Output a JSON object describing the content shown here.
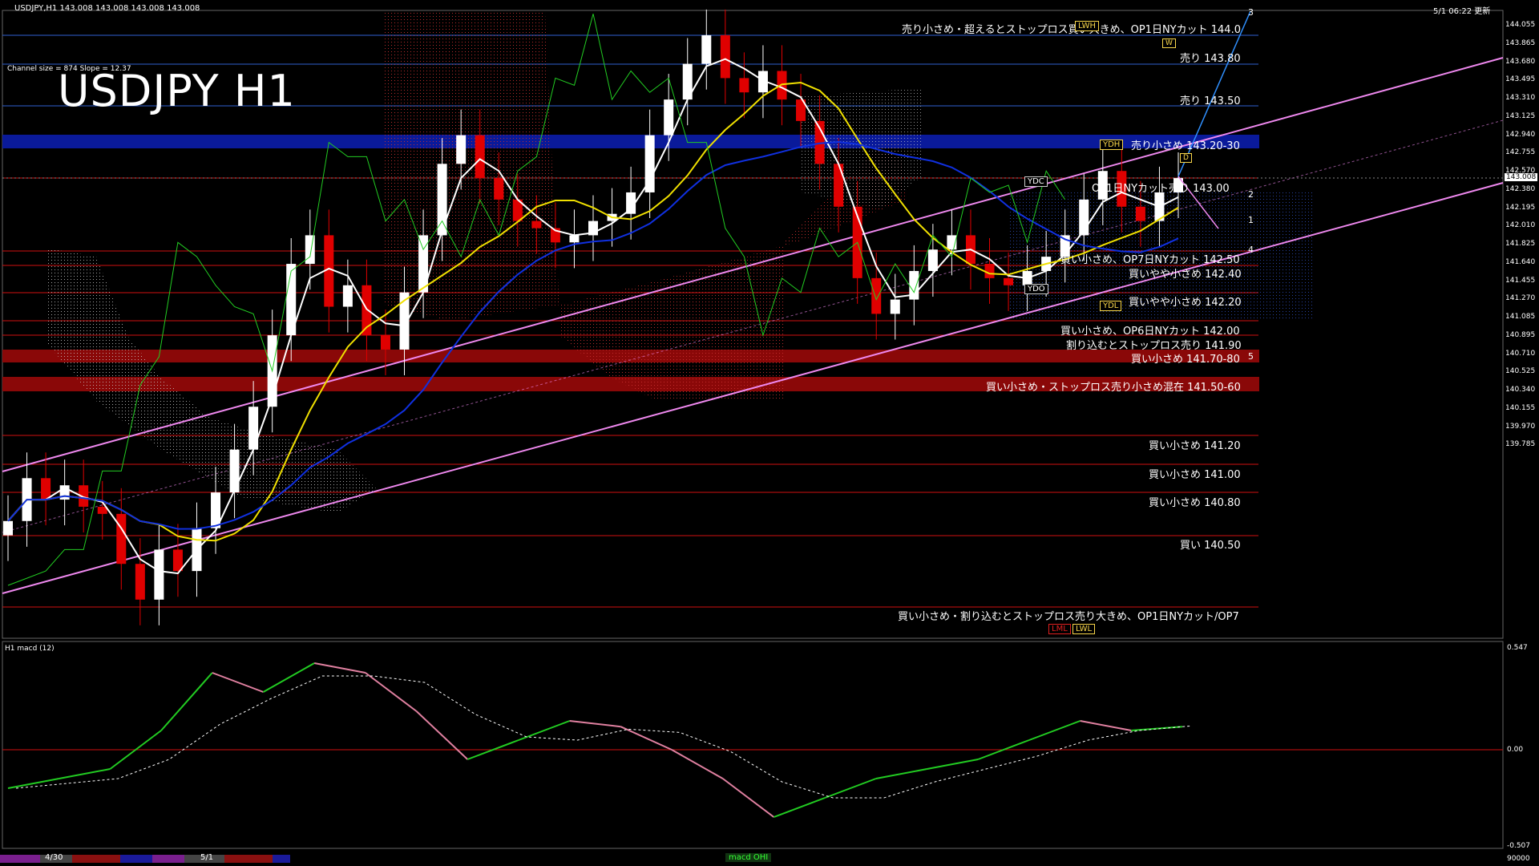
{
  "header": {
    "symbol_info": "USDJPY,H1  143.008 143.008 143.008 143.008",
    "datetime": "5/1 06:22 更新",
    "channel_info": "Channel size = 874 Slope = 12.37",
    "big_title": "USDJPY H1",
    "macd_label": "H1  macd (12)"
  },
  "price_axis": [
    "144.055",
    "143.865",
    "143.680",
    "143.495",
    "143.310",
    "143.125",
    "142.940",
    "142.755",
    "142.570",
    "142.380",
    "142.195",
    "142.010",
    "141.825",
    "141.640",
    "141.455",
    "141.270",
    "141.085",
    "140.895",
    "140.710",
    "140.525",
    "140.340",
    "140.155",
    "139.970",
    "139.785"
  ],
  "current_price": "143.008",
  "macd_axis": [
    "0.547",
    "0.00",
    "-0.507",
    "90000"
  ],
  "levels": [
    {
      "text": "売り小さめ・超えるとストップロス買い大きめ、OP1日NYカット 144.0"
    },
    {
      "text": "売り 143.80"
    },
    {
      "text": "売り 143.50"
    },
    {
      "text": "売り小さめ 143.20-30"
    },
    {
      "text": "OP1日NYカット売り 143.00"
    },
    {
      "text": "買い小さめ、OP7日NYカット 142.50"
    },
    {
      "text": "買いやや小さめ 142.40"
    },
    {
      "text": "買いやや小さめ 142.20"
    },
    {
      "text": "買い小さめ、OP6日NYカット 142.00"
    },
    {
      "text": "割り込むとストップロス売り 141.90"
    },
    {
      "text": "買い小さめ 141.70-80"
    },
    {
      "text": "買い小さめ・ストップロス売り小さめ混在 141.50-60"
    },
    {
      "text": "買い小さめ 141.20"
    },
    {
      "text": "買い小さめ 141.00"
    },
    {
      "text": "買い小さめ 140.80"
    },
    {
      "text": "買い 140.50"
    },
    {
      "text": "買い小さめ・割り込むとストップロス売り大きめ、OP1日NYカット/OP7"
    }
  ],
  "tags": {
    "lwh": "LWH",
    "ydh": "YDH",
    "ydc": "YDC",
    "ydo": "YDO",
    "ydl": "YDL",
    "lml": "LML",
    "lwl": "LWL",
    "w": "W",
    "d": "D"
  },
  "wave_labels": [
    "1",
    "2",
    "3",
    "4",
    "5"
  ],
  "bottom_bar": {
    "date1": "4/30",
    "date2": "5/1",
    "center": "macd OHI"
  },
  "colors": {
    "background": "#000000",
    "bull_candle": "#ffffff",
    "bear_candle": "#e00000",
    "sma_short": "#ffffff",
    "sma_mid": "#f0e000",
    "sma_long": "#1030e0",
    "channel": "#ee88ee",
    "cloud": "#c83030",
    "chikou": "#22cc22",
    "macd_up": "#22cc22",
    "macd_down": "#e080a0",
    "signal": "#ffffff"
  },
  "chart_data": {
    "type": "candlestick",
    "title": "USDJPY H1",
    "timeframe": "H1",
    "x_ticks": [
      "4/30",
      "5/1"
    ],
    "y_range": [
      139.785,
      144.15
    ],
    "series": [
      {
        "name": "price",
        "values": [
          140.6,
          140.9,
          140.75,
          140.85,
          140.7,
          140.65,
          140.3,
          140.05,
          140.4,
          140.25,
          140.55,
          140.8,
          141.1,
          141.4,
          141.9,
          142.4,
          142.6,
          142.1,
          142.25,
          141.9,
          141.8,
          142.2,
          142.6,
          143.1,
          143.3,
          143.0,
          142.85,
          142.7,
          142.65,
          142.55,
          142.6,
          142.7,
          142.75,
          142.9,
          143.3,
          143.55,
          143.8,
          144.0,
          143.7,
          143.6,
          143.75,
          143.55,
          143.4,
          143.1,
          142.8,
          142.3,
          142.05,
          142.15,
          142.35,
          142.5,
          142.6,
          142.4,
          142.3,
          142.25,
          142.35,
          142.45,
          142.6,
          142.85,
          143.05,
          142.8,
          142.7,
          142.9,
          143.0
        ]
      },
      {
        "name": "macd",
        "values": [
          -0.2,
          -0.15,
          -0.1,
          0.1,
          0.4,
          0.3,
          0.45,
          0.4,
          0.2,
          -0.05,
          0.05,
          0.15,
          0.12,
          0.0,
          -0.15,
          -0.35,
          -0.25,
          -0.15,
          -0.1,
          -0.05,
          0.05,
          0.15,
          0.1,
          0.12
        ]
      }
    ]
  }
}
